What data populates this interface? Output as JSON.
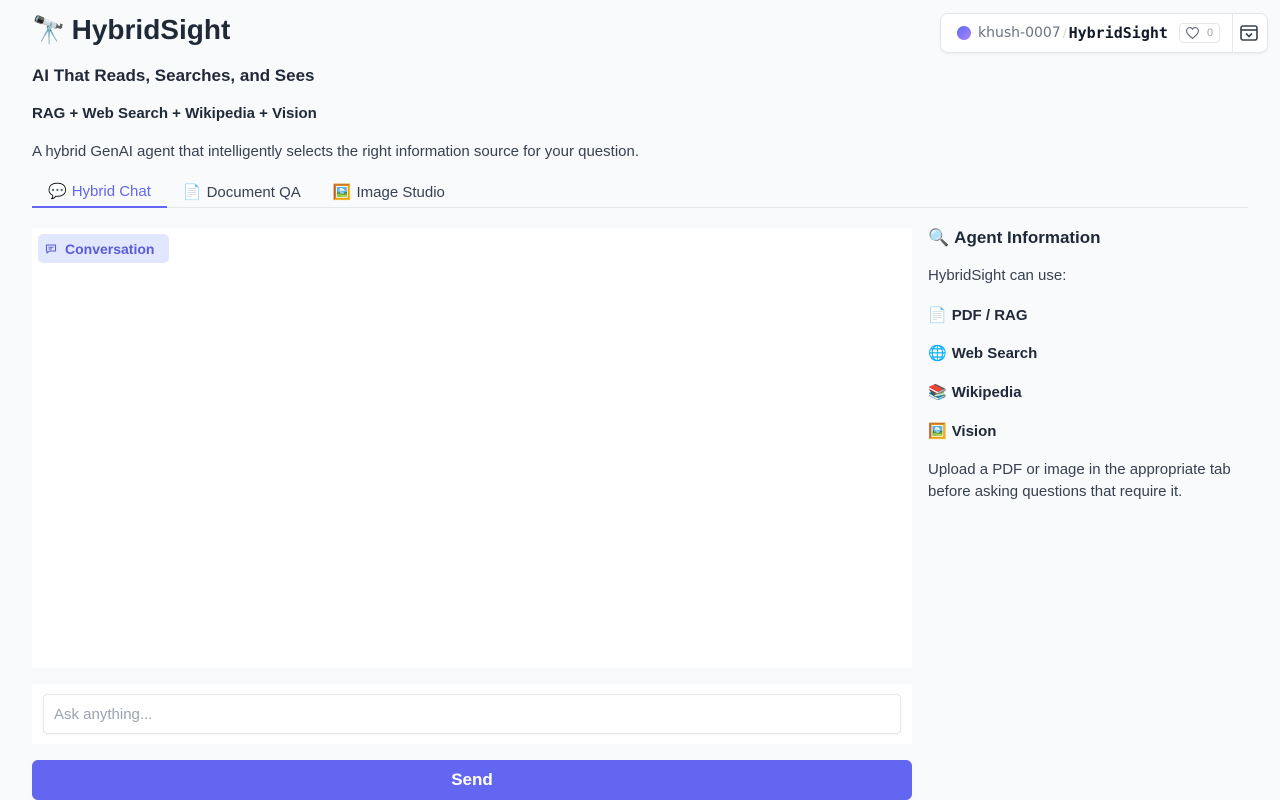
{
  "header": {
    "title_emoji": "🔭",
    "title": "HybridSight",
    "subtitle": "AI That Reads, Searches, and Sees",
    "features": "RAG + Web Search + Wikipedia + Vision",
    "description": "A hybrid GenAI agent that intelligently selects the right information source for your question."
  },
  "repo": {
    "owner": "khush-0007",
    "separator": "/",
    "name": "HybridSight",
    "likes": "0"
  },
  "tabs": [
    {
      "icon": "💬",
      "label": "Hybrid Chat",
      "active": true
    },
    {
      "icon": "📄",
      "label": "Document QA",
      "active": false
    },
    {
      "icon": "🖼️",
      "label": "Image Studio",
      "active": false
    }
  ],
  "chat": {
    "label": "Conversation",
    "placeholder": "Ask anything...",
    "send_label": "Send"
  },
  "agent": {
    "title_emoji": "🔍",
    "title": "Agent Information",
    "intro": "HybridSight can use:",
    "sources": [
      {
        "icon": "📄",
        "label": "PDF / RAG"
      },
      {
        "icon": "🌐",
        "label": "Web Search"
      },
      {
        "icon": "📚",
        "label": "Wikipedia"
      },
      {
        "icon": "🖼️",
        "label": "Vision"
      }
    ],
    "note": "Upload a PDF or image in the appropriate tab before asking questions that require it."
  },
  "colors": {
    "accent": "#6366f1",
    "accent_light": "#e0e7ff",
    "background": "#f8fafc"
  }
}
